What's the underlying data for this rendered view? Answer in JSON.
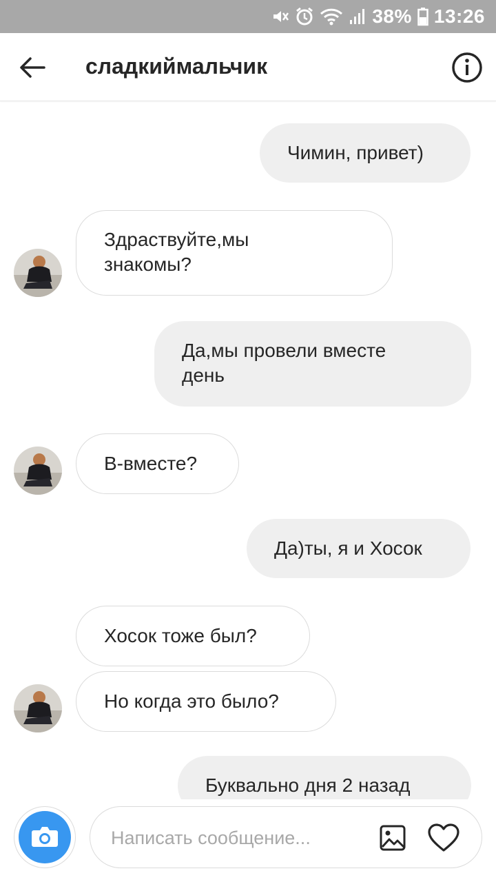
{
  "status_bar": {
    "battery_percent": "38%",
    "time": "13:26",
    "icons": [
      "mute-icon",
      "alarm-icon",
      "wifi-icon",
      "signal-icon",
      "battery-icon"
    ]
  },
  "header": {
    "title": "сладкиймальчик",
    "icons": [
      "back-arrow-icon",
      "info-icon"
    ]
  },
  "messages": [
    {
      "direction": "outgoing",
      "text": "Чимин, привет)"
    },
    {
      "direction": "incoming",
      "lines": [
        "Здраствуйте,мы",
        "знакомы?"
      ]
    },
    {
      "direction": "outgoing",
      "lines": [
        "Да,мы провели вместе",
        "день"
      ]
    },
    {
      "direction": "incoming",
      "text": "В-вместе?"
    },
    {
      "direction": "outgoing",
      "text": "Да)ты, я и Хосок"
    },
    {
      "direction": "incoming",
      "text": "Хосок тоже был?"
    },
    {
      "direction": "incoming",
      "text": "Но когда это было?"
    },
    {
      "direction": "outgoing",
      "text": "Буквально дня 2 назад"
    }
  ],
  "composer": {
    "placeholder": "Написать сообщение...",
    "icons": [
      "camera-icon",
      "gallery-icon",
      "heart-icon"
    ]
  },
  "colors": {
    "status_bar": "#a8a8a8",
    "outgoing_bubble": "#efefef",
    "incoming_border": "#dbdbdb",
    "camera_blue": "#3897f0",
    "text": "#262626"
  }
}
